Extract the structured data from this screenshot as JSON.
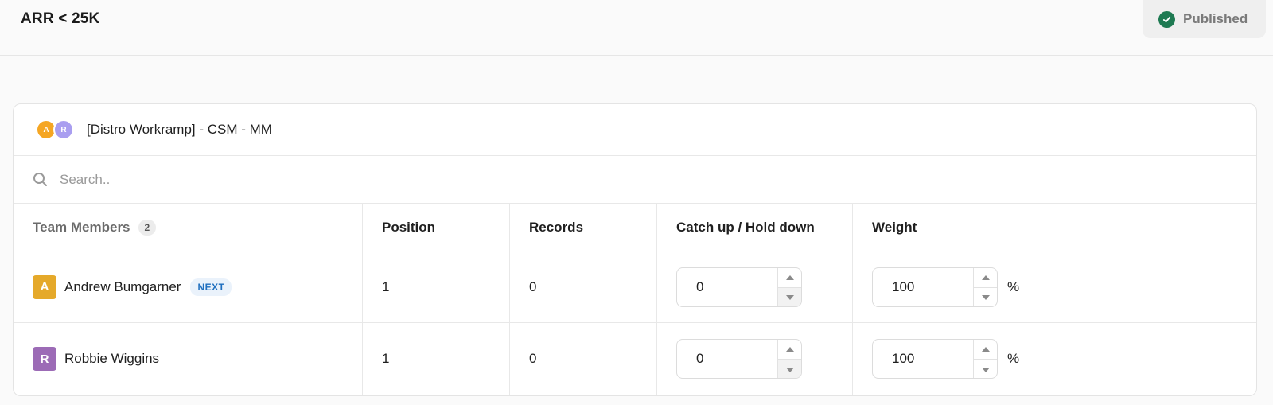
{
  "header": {
    "title": "ARR < 25K",
    "status": {
      "label": "Published",
      "icon": "check-circle-icon",
      "color": "#1e7a52"
    }
  },
  "team": {
    "name": "[Distro Workramp] - CSM - MM",
    "avatars": [
      {
        "initial": "A",
        "color": "#f5a623"
      },
      {
        "initial": "R",
        "color": "#a99ef0"
      }
    ]
  },
  "search": {
    "placeholder": "Search..",
    "value": ""
  },
  "table": {
    "columns": {
      "members": "Team Members",
      "position": "Position",
      "records": "Records",
      "catchup": "Catch up / Hold down",
      "weight": "Weight"
    },
    "member_count": "2",
    "rows": [
      {
        "initial": "A",
        "avatar_color": "#e5a92a",
        "name": "Andrew Bumgarner",
        "badge": "NEXT",
        "position": "1",
        "records": "0",
        "catchup": "0",
        "weight": "100",
        "unit": "%"
      },
      {
        "initial": "R",
        "avatar_color": "#9c6bb6",
        "name": "Robbie Wiggins",
        "badge": "",
        "position": "1",
        "records": "0",
        "catchup": "0",
        "weight": "100",
        "unit": "%"
      }
    ]
  }
}
